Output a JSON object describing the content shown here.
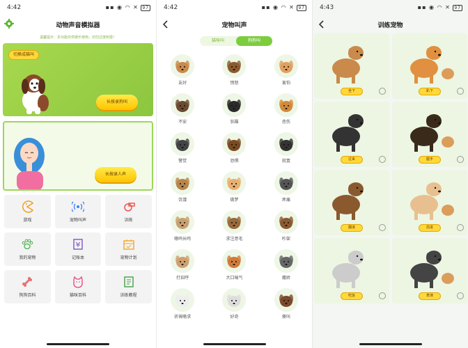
{
  "panels": [
    {
      "status": {
        "time": "4:42",
        "battery": "97"
      },
      "title": "动物声音模拟器",
      "tip": "温馨提示：本功能仅供娱乐使用，切勿过度刺激！",
      "switch_label": "切换成猫叫",
      "dog_hold_label": "长按录狗叫",
      "human_hold_label": "长按录人声",
      "menu": [
        {
          "label": "游戏",
          "icon": "pacman-icon"
        },
        {
          "label": "宠物叫声",
          "icon": "sound-wave-icon"
        },
        {
          "label": "训练",
          "icon": "whistle-icon"
        },
        {
          "label": "我的宠物",
          "icon": "paw-icon"
        },
        {
          "label": "记账本",
          "icon": "ledger-icon"
        },
        {
          "label": "宠物计划",
          "icon": "calendar-icon"
        },
        {
          "label": "狗狗百科",
          "icon": "bone-icon"
        },
        {
          "label": "猫咪百科",
          "icon": "cat-face-icon"
        },
        {
          "label": "训练教程",
          "icon": "tutorial-book-icon"
        }
      ]
    },
    {
      "status": {
        "time": "4:42",
        "battery": "97"
      },
      "title": "宠物叫声",
      "tabs": [
        "猫咪叫",
        "狗狗叫"
      ],
      "sounds": [
        "友好",
        "愤怒",
        "害怕",
        "不安",
        "狂躁",
        "悲伤",
        "警觉",
        "恐惧",
        "寂寞",
        "饥饿",
        "做梦",
        "疼痛",
        "嗷呜长鸣",
        "求注意毛",
        "吵架",
        "打招呼",
        "大口喘气",
        "撒娇",
        "祈祷嗷求",
        "好奇",
        "傻叫"
      ]
    },
    {
      "status": {
        "time": "4:43",
        "battery": "97"
      },
      "title": "训练宠物",
      "commands": [
        "坐下",
        "趴下",
        "过来",
        "握手",
        "翻滚",
        "前进",
        "吃饭",
        "表演"
      ]
    }
  ],
  "colors": {
    "green": "#7ccd3e",
    "yellow": "#ffd93b"
  }
}
